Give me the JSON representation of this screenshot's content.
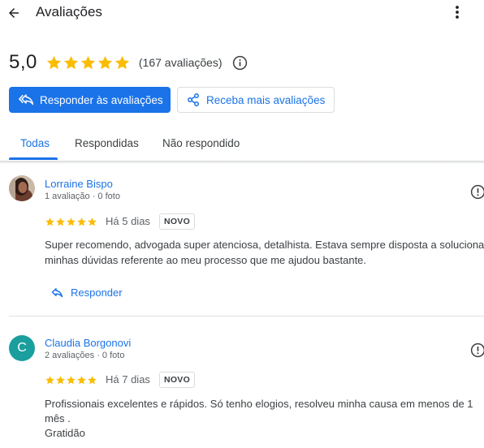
{
  "header": {
    "title": "Avaliações",
    "back_icon": "arrow-back-icon",
    "more_icon": "more-vert-icon"
  },
  "summary": {
    "rating": "5,0",
    "stars": 5,
    "count_label": "(167 avaliações)",
    "star_color": "#fbbc04",
    "info_icon": "info-icon"
  },
  "actions": {
    "reply_label": "Responder às avaliações",
    "get_more_label": "Receba mais avaliações",
    "primary_color": "#1a73e8"
  },
  "tabs": [
    {
      "label": "Todas",
      "active": true
    },
    {
      "label": "Respondidas",
      "active": false
    },
    {
      "label": "Não respondido",
      "active": false
    }
  ],
  "reviews": [
    {
      "name": "Lorraine Bispo",
      "meta": "1 avaliação · 0 foto",
      "stars": 5,
      "date": "Há 5 dias",
      "badge": "NOVO",
      "text_lines": [
        "Super recomendo, advogada super atenciosa, detalhista. Estava sempre disposta a solucionar",
        "minhas dúvidas referente ao meu processo que me ajudou bastante."
      ],
      "reply_label": "Responder",
      "avatar": "photo"
    },
    {
      "name": "Claudia Borgonovi",
      "meta": "2 avaliações · 0 foto",
      "stars": 5,
      "date": "Há 7 dias",
      "badge": "NOVO",
      "text_lines": [
        "Profissionais excelentes e rápidos. Só tenho elogios, resolveu minha causa em menos de 1",
        "mês .",
        "Gratidão"
      ],
      "avatar_letter": "C",
      "avatar_color": "#1a9e9e"
    }
  ]
}
